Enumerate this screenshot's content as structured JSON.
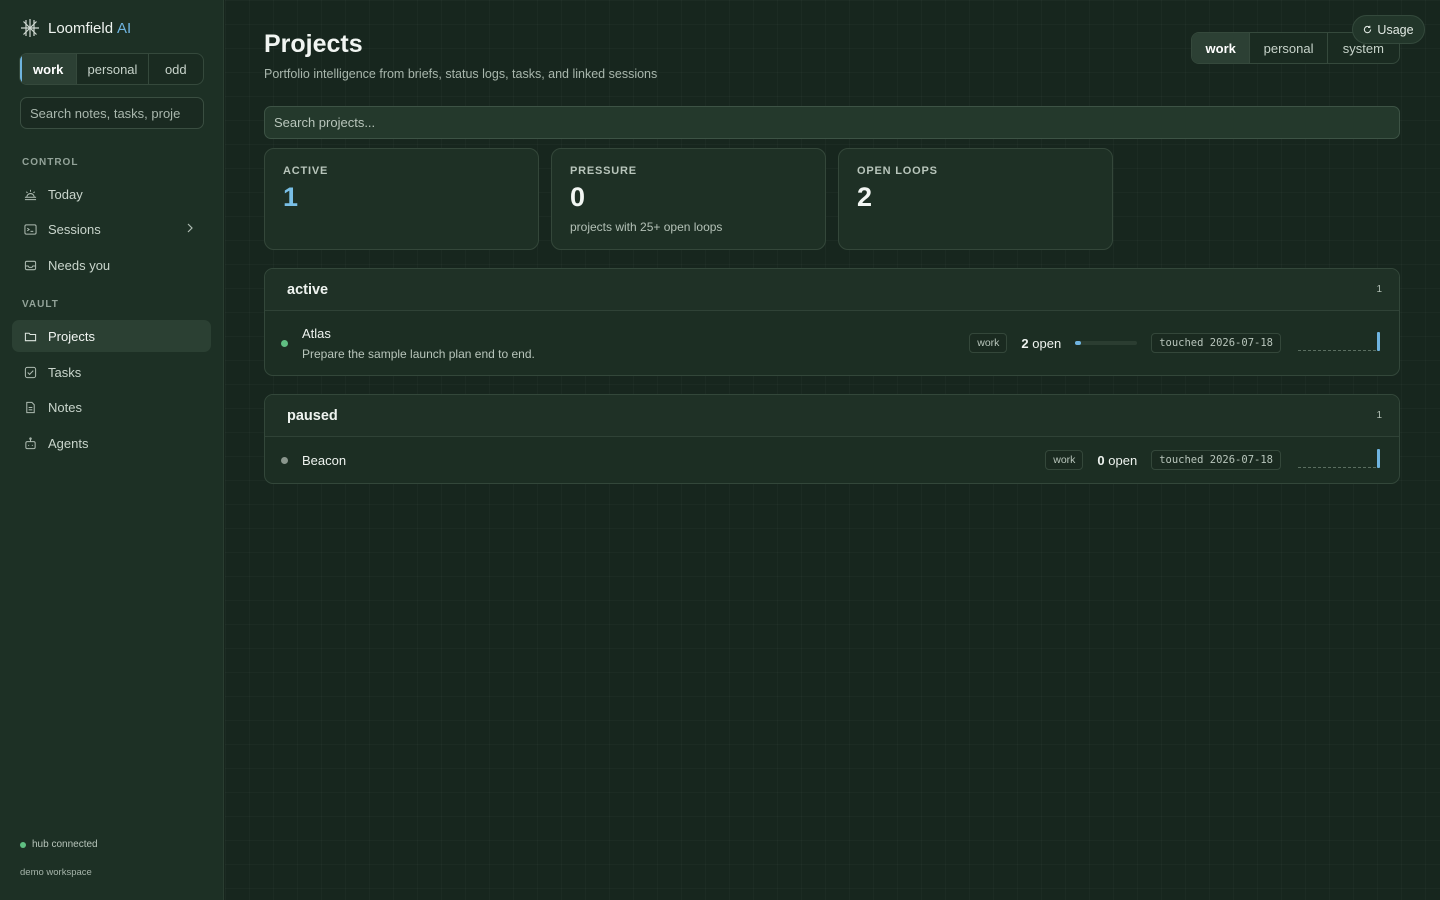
{
  "app": {
    "name": "Loomfield",
    "name_accent": "AI"
  },
  "sidebar": {
    "workspace_tabs": [
      "work",
      "personal",
      "odd"
    ],
    "workspace_active": "work",
    "search_placeholder": "Search notes, tasks, proje",
    "control_label": "CONTROL",
    "control_items": [
      {
        "label": "Today",
        "icon": "sun-icon"
      },
      {
        "label": "Sessions",
        "icon": "terminal-icon"
      },
      {
        "label": "Needs you",
        "icon": "inbox-icon"
      }
    ],
    "vault_label": "VAULT",
    "vault_items": [
      {
        "label": "Projects",
        "icon": "folder-icon",
        "active": true
      },
      {
        "label": "Tasks",
        "icon": "checkbox-icon"
      },
      {
        "label": "Notes",
        "icon": "document-icon"
      },
      {
        "label": "Agents",
        "icon": "robot-icon"
      }
    ],
    "status_text": "hub connected",
    "workspace_name": "demo workspace"
  },
  "header": {
    "title": "Projects",
    "subtitle": "Portfolio intelligence from briefs, status logs, tasks, and linked sessions",
    "usage_label": "Usage",
    "scope_tabs": [
      "work",
      "personal",
      "system"
    ],
    "scope_active": "work",
    "search_placeholder": "Search projects..."
  },
  "stats": [
    {
      "label": "ACTIVE",
      "value": "1",
      "sub": ""
    },
    {
      "label": "PRESSURE",
      "value": "0",
      "sub": "projects with 25+ open loops"
    },
    {
      "label": "OPEN LOOPS",
      "value": "2",
      "sub": ""
    }
  ],
  "groups": [
    {
      "name": "active",
      "count": "1",
      "projects": [
        {
          "name": "Atlas",
          "description": "Prepare the sample launch plan end to end.",
          "tag": "work",
          "open_num": "2",
          "open_label": "open",
          "progress": 0.1,
          "touched": "touched 2026-07-18",
          "status_color": "#5fbf82"
        }
      ]
    },
    {
      "name": "paused",
      "count": "1",
      "projects": [
        {
          "name": "Beacon",
          "description": "",
          "tag": "work",
          "open_num": "0",
          "open_label": "open",
          "progress": 0,
          "touched": "touched 2026-07-18",
          "status_color": "#8a968d"
        }
      ]
    }
  ],
  "colors": {
    "accent": "#6fb4e0",
    "status_ok": "#5fbf82",
    "status_paused": "#8a968d"
  }
}
